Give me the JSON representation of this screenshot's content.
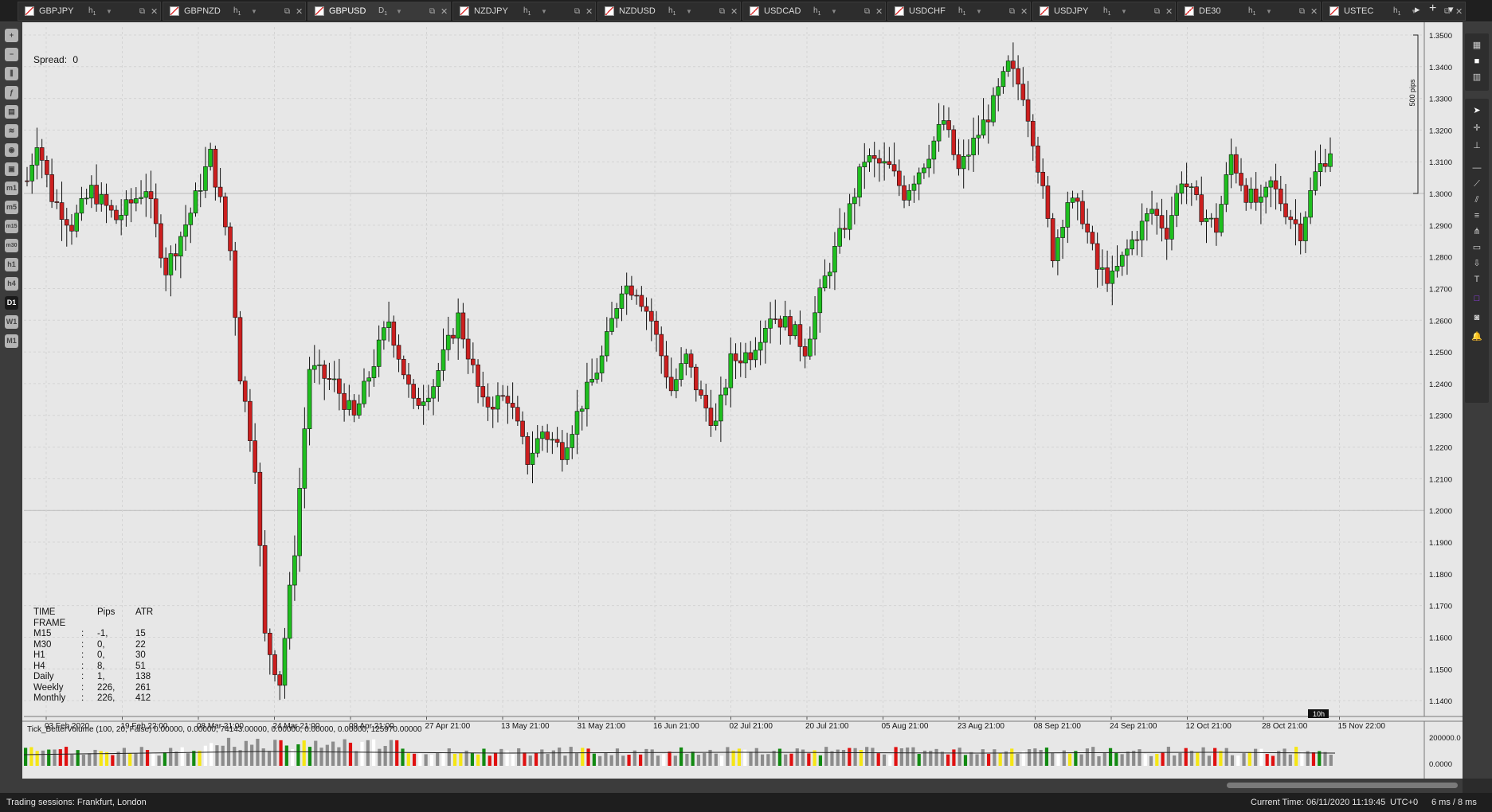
{
  "tabs": [
    {
      "symbol": "GBPJPY",
      "tf": "h",
      "tfsub": "1",
      "active": false
    },
    {
      "symbol": "GBPNZD",
      "tf": "h",
      "tfsub": "1",
      "active": false
    },
    {
      "symbol": "GBPUSD",
      "tf": "D",
      "tfsub": "1",
      "active": true
    },
    {
      "symbol": "NZDJPY",
      "tf": "h",
      "tfsub": "1",
      "active": false
    },
    {
      "symbol": "NZDUSD",
      "tf": "h",
      "tfsub": "1",
      "active": false
    },
    {
      "symbol": "USDCAD",
      "tf": "h",
      "tfsub": "1",
      "active": false
    },
    {
      "symbol": "USDCHF",
      "tf": "h",
      "tfsub": "1",
      "active": false
    },
    {
      "symbol": "USDJPY",
      "tf": "h",
      "tfsub": "1",
      "active": false
    },
    {
      "symbol": "DE30",
      "tf": "h",
      "tfsub": "1",
      "active": false
    },
    {
      "symbol": "USTEC",
      "tf": "h",
      "tfsub": "1",
      "active": false
    }
  ],
  "left_toolbar": [
    {
      "icon": "zoom-in-icon",
      "label": "+"
    },
    {
      "icon": "zoom-out-icon",
      "label": "−"
    },
    {
      "icon": "chart-type-icon",
      "label": "⫼"
    },
    {
      "icon": "indicators-icon",
      "label": "ƒ"
    },
    {
      "icon": "templates-icon",
      "label": "▤"
    },
    {
      "icon": "layers-icon",
      "label": "≋"
    },
    {
      "icon": "eye-icon",
      "label": "◉"
    },
    {
      "icon": "screenshot-icon",
      "label": "▣"
    },
    {
      "icon": "tf-m1-icon",
      "label": "m1"
    },
    {
      "icon": "tf-m5-icon",
      "label": "m5"
    },
    {
      "icon": "tf-m15-icon",
      "label": "m15"
    },
    {
      "icon": "tf-m30-icon",
      "label": "m30"
    },
    {
      "icon": "tf-h1-icon",
      "label": "h1"
    },
    {
      "icon": "tf-h4-icon",
      "label": "h4"
    },
    {
      "icon": "tf-d1-icon",
      "label": "D1",
      "selected": true
    },
    {
      "icon": "tf-w1-icon",
      "label": "W1"
    },
    {
      "icon": "tf-mn1-icon",
      "label": "M1"
    }
  ],
  "right_toolbar": [
    {
      "icon": "grid-layout-icon",
      "label": "▦"
    },
    {
      "icon": "single-chart-icon",
      "label": "■"
    },
    {
      "icon": "multi-chart-icon",
      "label": "▥"
    },
    {
      "icon": "cursor-icon",
      "label": "➤"
    },
    {
      "icon": "crosshair-icon",
      "label": "✛"
    },
    {
      "icon": "measure-icon",
      "label": "⊥"
    },
    {
      "icon": "horizontal-line-icon",
      "label": "—"
    },
    {
      "icon": "trendline-icon",
      "label": "⟋"
    },
    {
      "icon": "channel-icon",
      "label": "⫽"
    },
    {
      "icon": "fibonacci-icon",
      "label": "≡"
    },
    {
      "icon": "pitchfork-icon",
      "label": "⋔"
    },
    {
      "icon": "rectangle-icon",
      "label": "▭"
    },
    {
      "icon": "arrow-icon",
      "label": "⇩"
    },
    {
      "icon": "text-icon",
      "label": "T"
    },
    {
      "icon": "color-icon",
      "label": "□"
    },
    {
      "icon": "camera-icon",
      "label": "◙"
    },
    {
      "icon": "alert-bell-icon",
      "label": "🔔"
    }
  ],
  "tab_controls": {
    "scroll": "▸",
    "add": "+",
    "menu": "▾"
  },
  "spread_label": "Spread:",
  "spread_value": "0",
  "timeframe_table": {
    "headers": [
      "TIME FRAME",
      "",
      "Pips",
      "ATR"
    ],
    "rows": [
      [
        "M15",
        ":",
        "-1,",
        "15"
      ],
      [
        "M30",
        ":",
        "0,",
        "22"
      ],
      [
        "H1",
        ":",
        "0,",
        "30"
      ],
      [
        "H4",
        ":",
        "8,",
        "51"
      ],
      [
        "Daily",
        ":",
        "1,",
        "138"
      ],
      [
        "Weekly",
        ":",
        "226,",
        "261"
      ],
      [
        "Monthly",
        ":",
        "226,",
        "412"
      ]
    ]
  },
  "pips_label": "500 pips",
  "countdown_label": "10h",
  "indicator_label": "Tick_BetterVolume (100, 20, False) 0.00000, 0.00000, 74143.00000, 0.00000, 0.00000, 0.00000, 125970.00000",
  "indicator_axis": [
    "200000.0",
    "0.0000"
  ],
  "status": {
    "sessions": "Trading sessions: Frankfurt, London",
    "current_time_label": "Current Time:",
    "current_time": "06/11/2020 11:19:45",
    "timezone": "UTC+0",
    "latency": "6 ms / 8 ms"
  },
  "colors": {
    "bull": "#1fbf1f",
    "bear": "#cc1f1f",
    "background": "#e7e7e7",
    "vol_default": "#8c8c8c",
    "vol_white": "#ffffff",
    "vol_yellow": "#f5e614",
    "vol_green": "#128a12",
    "vol_red": "#e01010"
  },
  "chart_data": {
    "type": "candlestick",
    "symbol": "GBPUSD",
    "timeframe": "D1",
    "ylim": [
      1.135,
      1.3525
    ],
    "y_ticks": [
      "1.3500",
      "1.3400",
      "1.3300",
      "1.3200",
      "1.3100",
      "1.3000",
      "1.2900",
      "1.2800",
      "1.2700",
      "1.2600",
      "1.2500",
      "1.2400",
      "1.2300",
      "1.2200",
      "1.2100",
      "1.2000",
      "1.1900",
      "1.1800",
      "1.1700",
      "1.1600",
      "1.1500",
      "1.1400"
    ],
    "x_ticks": [
      "03 Feb 2020",
      "19 Feb 22:00",
      "08 Mar 21:00",
      "24 Mar 21:00",
      "09 Apr 21:00",
      "27 Apr 21:00",
      "13 May 21:00",
      "31 May 21:00",
      "16 Jun 21:00",
      "02 Jul 21:00",
      "20 Jul 21:00",
      "05 Aug 21:00",
      "23 Aug 21:00",
      "08 Sep 21:00",
      "24 Sep 21:00",
      "12 Oct 21:00",
      "28 Oct 21:00",
      "15 Nov 22:00"
    ],
    "waypoints": [
      [
        0,
        1.304
      ],
      [
        2,
        1.317
      ],
      [
        5,
        1.299
      ],
      [
        9,
        1.29
      ],
      [
        13,
        1.301
      ],
      [
        18,
        1.292
      ],
      [
        24,
        1.302
      ],
      [
        28,
        1.276
      ],
      [
        33,
        1.294
      ],
      [
        37,
        1.312
      ],
      [
        41,
        1.282
      ],
      [
        43,
        1.243
      ],
      [
        46,
        1.215
      ],
      [
        48,
        1.16
      ],
      [
        51,
        1.146
      ],
      [
        54,
        1.188
      ],
      [
        57,
        1.245
      ],
      [
        62,
        1.24
      ],
      [
        66,
        1.229
      ],
      [
        70,
        1.247
      ],
      [
        73,
        1.26
      ],
      [
        78,
        1.233
      ],
      [
        82,
        1.24
      ],
      [
        87,
        1.261
      ],
      [
        92,
        1.233
      ],
      [
        97,
        1.236
      ],
      [
        101,
        1.216
      ],
      [
        104,
        1.225
      ],
      [
        108,
        1.219
      ],
      [
        112,
        1.234
      ],
      [
        116,
        1.248
      ],
      [
        120,
        1.271
      ],
      [
        123,
        1.27
      ],
      [
        126,
        1.26
      ],
      [
        130,
        1.238
      ],
      [
        133,
        1.248
      ],
      [
        136,
        1.235
      ],
      [
        139,
        1.227
      ],
      [
        142,
        1.247
      ],
      [
        146,
        1.25
      ],
      [
        150,
        1.262
      ],
      [
        154,
        1.258
      ],
      [
        157,
        1.251
      ],
      [
        161,
        1.273
      ],
      [
        166,
        1.295
      ],
      [
        169,
        1.311
      ],
      [
        174,
        1.308
      ],
      [
        177,
        1.3
      ],
      [
        181,
        1.31
      ],
      [
        185,
        1.323
      ],
      [
        188,
        1.307
      ],
      [
        191,
        1.316
      ],
      [
        195,
        1.328
      ],
      [
        198,
        1.34
      ],
      [
        201,
        1.332
      ],
      [
        203,
        1.318
      ],
      [
        205,
        1.3
      ],
      [
        207,
        1.281
      ],
      [
        210,
        1.298
      ],
      [
        213,
        1.293
      ],
      [
        216,
        1.276
      ],
      [
        219,
        1.273
      ],
      [
        223,
        1.285
      ],
      [
        227,
        1.295
      ],
      [
        230,
        1.288
      ],
      [
        233,
        1.305
      ],
      [
        237,
        1.294
      ],
      [
        240,
        1.289
      ],
      [
        243,
        1.312
      ],
      [
        246,
        1.3
      ],
      [
        249,
        1.296
      ],
      [
        251,
        1.303
      ],
      [
        254,
        1.295
      ],
      [
        257,
        1.288
      ],
      [
        260,
        1.306
      ],
      [
        263,
        1.314
      ]
    ]
  }
}
